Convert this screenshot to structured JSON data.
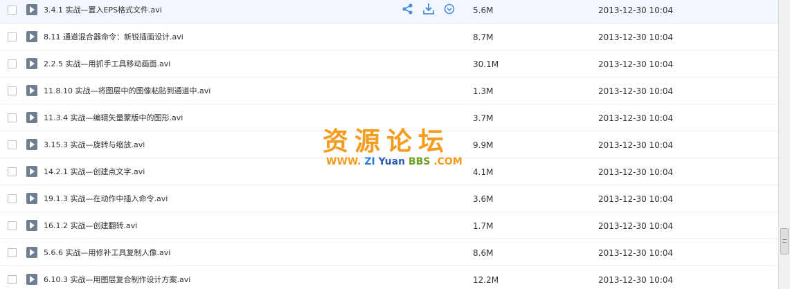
{
  "files": [
    {
      "name": "3.4.1 实战—置入EPS格式文件.avi",
      "size": "5.6M",
      "date": "2013-12-30 10:04"
    },
    {
      "name": "8.11 通道混合器命令：新锐插画设计.avi",
      "size": "8.7M",
      "date": "2013-12-30 10:04"
    },
    {
      "name": "2.2.5 实战—用抓手工具移动画面.avi",
      "size": "30.1M",
      "date": "2013-12-30 10:04"
    },
    {
      "name": "11.8.10 实战—将图层中的图像粘贴到通道中.avi",
      "size": "1.3M",
      "date": "2013-12-30 10:04"
    },
    {
      "name": "11.3.4 实战—编辑矢量蒙版中的图形.avi",
      "size": "3.7M",
      "date": "2013-12-30 10:04"
    },
    {
      "name": "3.15.3 实战—旋转与缩放.avi",
      "size": "9.9M",
      "date": "2013-12-30 10:04"
    },
    {
      "name": "14.2.1 实战—创建点文字.avi",
      "size": "4.1M",
      "date": "2013-12-30 10:04"
    },
    {
      "name": "19.1.3 实战—在动作中插入命令.avi",
      "size": "3.6M",
      "date": "2013-12-30 10:04"
    },
    {
      "name": "16.1.2 实战—创建翻转.avi",
      "size": "1.7M",
      "date": "2013-12-30 10:04"
    },
    {
      "name": "5.6.6 实战—用修补工具复制人像.avi",
      "size": "8.6M",
      "date": "2013-12-30 10:04"
    },
    {
      "name": "6.10.3 实战—用图层复合制作设计方案.avi",
      "size": "12.2M",
      "date": "2013-12-30 10:04"
    }
  ],
  "row_actions": [
    "share-icon",
    "download-icon",
    "more-icon"
  ],
  "watermark": {
    "title": "资源论坛",
    "url_www": "WWW.",
    "url_zi": "ZI",
    "url_yuan": "Yuan",
    "url_bbs": "BBS",
    "url_com": ".COM"
  },
  "colors": {
    "hover_row": "#f2f7fd",
    "action_icon": "#4a90d9",
    "file_icon": "#6f7f91",
    "watermark_orange": "#f39c1e"
  }
}
